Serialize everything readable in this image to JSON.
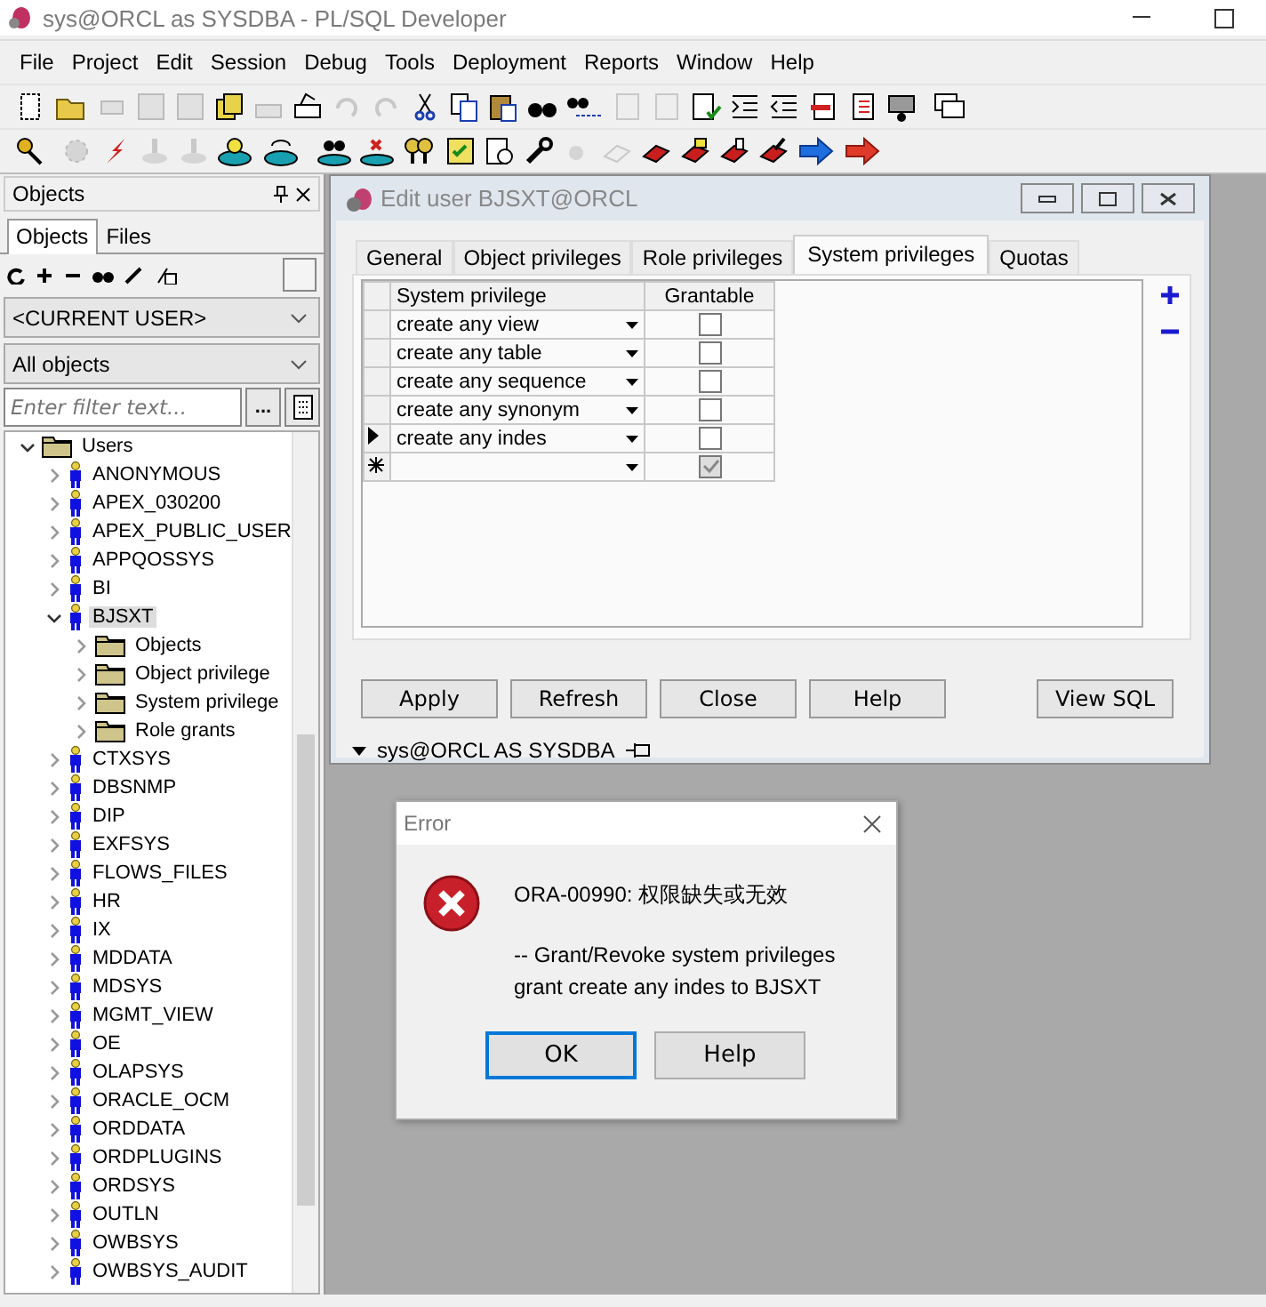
{
  "window": {
    "title": "sys@ORCL as SYSDBA - PL/SQL Developer"
  },
  "menu": [
    "File",
    "Project",
    "Edit",
    "Session",
    "Debug",
    "Tools",
    "Deployment",
    "Reports",
    "Window",
    "Help"
  ],
  "objects_panel": {
    "title": "Objects",
    "tabs": [
      {
        "label": "Objects",
        "selected": true
      },
      {
        "label": "Files",
        "selected": false
      }
    ],
    "owner_select": "<CURRENT USER>",
    "type_select": "All objects",
    "filter": {
      "placeholder": "Enter filter text..."
    },
    "filter_button": "...",
    "tree": [
      {
        "label": "Users",
        "kind": "folder",
        "expanded": true,
        "selected": false,
        "children": [
          {
            "label": "ANONYMOUS",
            "kind": "user",
            "expanded": false,
            "selected": false
          },
          {
            "label": "APEX_030200",
            "kind": "user",
            "expanded": false,
            "selected": false
          },
          {
            "label": "APEX_PUBLIC_USER",
            "kind": "user",
            "expanded": false,
            "selected": false
          },
          {
            "label": "APPQOSSYS",
            "kind": "user",
            "expanded": false,
            "selected": false
          },
          {
            "label": "BI",
            "kind": "user",
            "expanded": false,
            "selected": false
          },
          {
            "label": "BJSXT",
            "kind": "user",
            "expanded": true,
            "selected": true,
            "children": [
              {
                "label": "Objects",
                "kind": "folder",
                "expanded": false,
                "selected": false
              },
              {
                "label": "Object privilege",
                "kind": "folder",
                "expanded": false,
                "selected": false
              },
              {
                "label": "System privilege",
                "kind": "folder",
                "expanded": false,
                "selected": false
              },
              {
                "label": "Role grants",
                "kind": "folder",
                "expanded": false,
                "selected": false
              }
            ]
          },
          {
            "label": "CTXSYS",
            "kind": "user",
            "expanded": false,
            "selected": false
          },
          {
            "label": "DBSNMP",
            "kind": "user",
            "expanded": false,
            "selected": false
          },
          {
            "label": "DIP",
            "kind": "user",
            "expanded": false,
            "selected": false
          },
          {
            "label": "EXFSYS",
            "kind": "user",
            "expanded": false,
            "selected": false
          },
          {
            "label": "FLOWS_FILES",
            "kind": "user",
            "expanded": false,
            "selected": false
          },
          {
            "label": "HR",
            "kind": "user",
            "expanded": false,
            "selected": false
          },
          {
            "label": "IX",
            "kind": "user",
            "expanded": false,
            "selected": false
          },
          {
            "label": "MDDATA",
            "kind": "user",
            "expanded": false,
            "selected": false
          },
          {
            "label": "MDSYS",
            "kind": "user",
            "expanded": false,
            "selected": false
          },
          {
            "label": "MGMT_VIEW",
            "kind": "user",
            "expanded": false,
            "selected": false
          },
          {
            "label": "OE",
            "kind": "user",
            "expanded": false,
            "selected": false
          },
          {
            "label": "OLAPSYS",
            "kind": "user",
            "expanded": false,
            "selected": false
          },
          {
            "label": "ORACLE_OCM",
            "kind": "user",
            "expanded": false,
            "selected": false
          },
          {
            "label": "ORDDATA",
            "kind": "user",
            "expanded": false,
            "selected": false
          },
          {
            "label": "ORDPLUGINS",
            "kind": "user",
            "expanded": false,
            "selected": false
          },
          {
            "label": "ORDSYS",
            "kind": "user",
            "expanded": false,
            "selected": false
          },
          {
            "label": "OUTLN",
            "kind": "user",
            "expanded": false,
            "selected": false
          },
          {
            "label": "OWBSYS",
            "kind": "user",
            "expanded": false,
            "selected": false
          },
          {
            "label": "OWBSYS_AUDIT",
            "kind": "user",
            "expanded": false,
            "selected": false
          }
        ]
      }
    ]
  },
  "edit_user": {
    "title": "Edit user BJSXT@ORCL",
    "tabs": [
      {
        "label": "General",
        "selected": false
      },
      {
        "label": "Object privileges",
        "selected": false
      },
      {
        "label": "Role privileges",
        "selected": false
      },
      {
        "label": "System privileges",
        "selected": true
      },
      {
        "label": "Quotas",
        "selected": false
      }
    ],
    "columns": [
      "System privilege",
      "Grantable"
    ],
    "rows": [
      {
        "kind": "row",
        "privilege": "create any view",
        "grantable": false,
        "current": false
      },
      {
        "kind": "row",
        "privilege": "create any table",
        "grantable": false,
        "current": false
      },
      {
        "kind": "row",
        "privilege": "create any sequence",
        "grantable": false,
        "current": false
      },
      {
        "kind": "row",
        "privilege": "create any synonym",
        "grantable": false,
        "current": false
      },
      {
        "kind": "row",
        "privilege": "create any indes",
        "grantable": false,
        "current": true
      },
      {
        "kind": "new",
        "grantable": true
      }
    ],
    "buttons": [
      "Apply",
      "Refresh",
      "Close",
      "Help",
      "View SQL"
    ],
    "status": "sys@ORCL AS SYSDBA"
  },
  "error_dialog": {
    "title": "Error",
    "message": "ORA-00990: 权限缺失或无效",
    "details": [
      "-- Grant/Revoke system privileges",
      "grant create any indes to BJSXT"
    ],
    "buttons": [
      {
        "label": "OK",
        "selected": true
      },
      {
        "label": "Help",
        "selected": false
      }
    ]
  }
}
